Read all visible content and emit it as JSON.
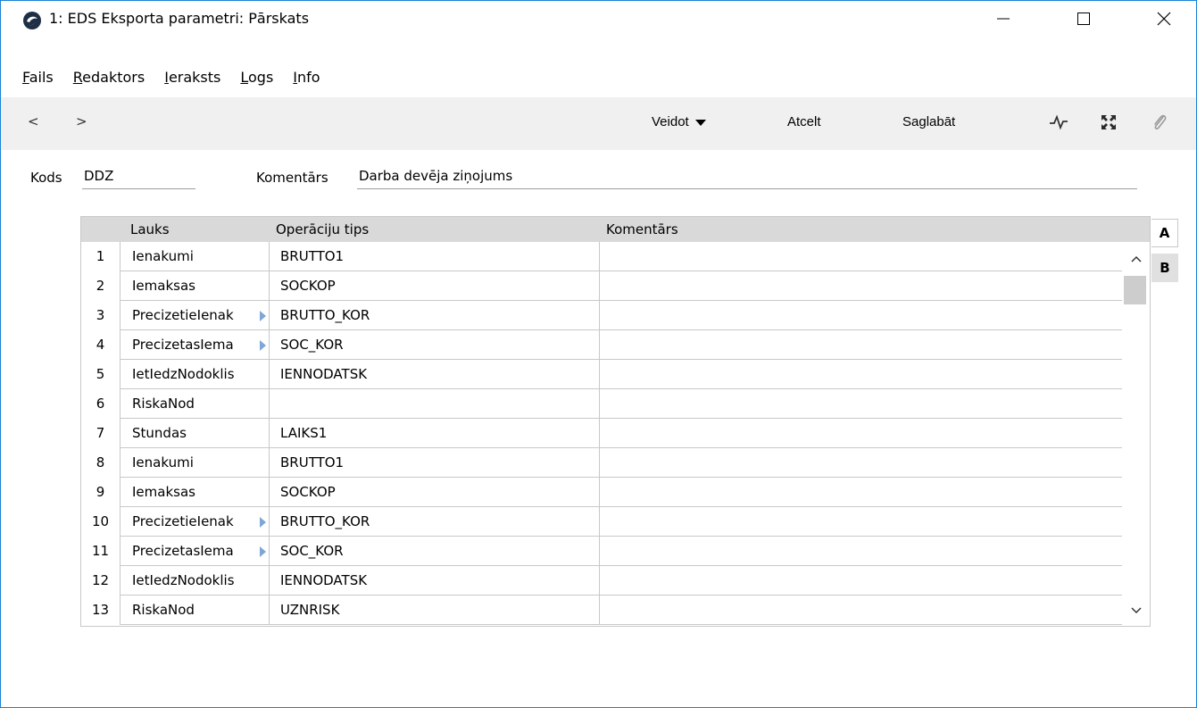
{
  "window": {
    "title": "1: EDS Eksporta parametri: Pārskats"
  },
  "menu": [
    {
      "acc": "F",
      "rest": "ails"
    },
    {
      "acc": "R",
      "rest": "edaktors"
    },
    {
      "acc": "I",
      "rest": "eraksts"
    },
    {
      "acc": "L",
      "rest": "ogs"
    },
    {
      "acc": "I",
      "rest": "nfo"
    }
  ],
  "toolbar": {
    "prev": "<",
    "next": ">",
    "create_label": "Veidot",
    "cancel_label": "Atcelt",
    "save_label": "Saglabāt"
  },
  "header": {
    "code_label": "Kods",
    "code_value": "DDZ",
    "comment_label": "Komentārs",
    "comment_value": "Darba devēja ziņojums"
  },
  "grid": {
    "columns": [
      "Lauks",
      "Operāciju tips",
      "Komentārs"
    ],
    "rows": [
      {
        "num": "1",
        "lauks": "Ienakumi",
        "op": "BRUTTO1",
        "kom": "",
        "more": false
      },
      {
        "num": "2",
        "lauks": "Iemaksas",
        "op": "SOCKOP",
        "kom": "",
        "more": false
      },
      {
        "num": "3",
        "lauks": "PrecizetieIenak",
        "op": "BRUTTO_KOR",
        "kom": "",
        "more": true
      },
      {
        "num": "4",
        "lauks": "PrecizetasIema",
        "op": "SOC_KOR",
        "kom": "",
        "more": true
      },
      {
        "num": "5",
        "lauks": "IetIedzNodoklis",
        "op": "IENNODATSK",
        "kom": "",
        "more": false
      },
      {
        "num": "6",
        "lauks": "RiskaNod",
        "op": "",
        "kom": "",
        "more": false
      },
      {
        "num": "7",
        "lauks": "Stundas",
        "op": "LAIKS1",
        "kom": "",
        "more": false
      },
      {
        "num": "8",
        "lauks": "Ienakumi",
        "op": "BRUTTO1",
        "kom": "",
        "more": false
      },
      {
        "num": "9",
        "lauks": "Iemaksas",
        "op": "SOCKOP",
        "kom": "",
        "more": false
      },
      {
        "num": "10",
        "lauks": "PrecizetieIenak",
        "op": "BRUTTO_KOR",
        "kom": "",
        "more": true
      },
      {
        "num": "11",
        "lauks": "PrecizetasIema",
        "op": "SOC_KOR",
        "kom": "",
        "more": true
      },
      {
        "num": "12",
        "lauks": "IetIedzNodoklis",
        "op": "IENNODATSK",
        "kom": "",
        "more": false
      },
      {
        "num": "13",
        "lauks": "RiskaNod",
        "op": "UZNRISK",
        "kom": "",
        "more": false
      }
    ]
  },
  "tabs": [
    "A",
    "B"
  ]
}
